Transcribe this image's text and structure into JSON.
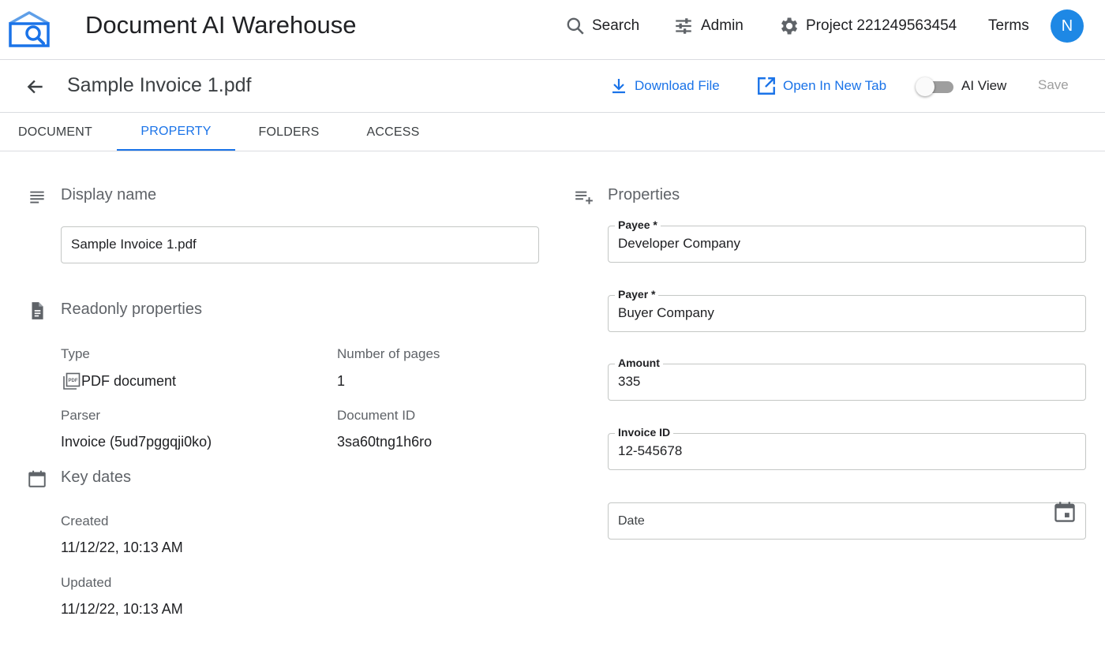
{
  "app": {
    "title": "Document AI Warehouse"
  },
  "topnav": {
    "search": "Search",
    "admin": "Admin",
    "project": "Project 221249563454",
    "terms": "Terms",
    "avatar_initial": "N"
  },
  "doc": {
    "title": "Sample Invoice 1.pdf",
    "download": "Download File",
    "open_new_tab": "Open In New Tab",
    "ai_view": "AI View",
    "save": "Save"
  },
  "tabs": [
    "DOCUMENT",
    "PROPERTY",
    "FOLDERS",
    "ACCESS"
  ],
  "display_name": {
    "title": "Display name",
    "value": "Sample Invoice 1.pdf"
  },
  "readonly": {
    "title": "Readonly properties",
    "type_label": "Type",
    "type_value": "PDF document",
    "pages_label": "Number of pages",
    "pages_value": "1",
    "parser_label": "Parser",
    "parser_value": "Invoice (5ud7pggqji0ko)",
    "docid_label": "Document ID",
    "docid_value": "3sa60tng1h6ro"
  },
  "dates": {
    "title": "Key dates",
    "created_label": "Created",
    "created_value": "11/12/22, 10:13 AM",
    "updated_label": "Updated",
    "updated_value": "11/12/22, 10:13 AM"
  },
  "properties": {
    "title": "Properties",
    "payee_label": "Payee *",
    "payee_value": "Developer Company",
    "payer_label": "Payer *",
    "payer_value": "Buyer Company",
    "amount_label": "Amount",
    "amount_value": "335",
    "invoice_label": "Invoice ID",
    "invoice_value": "12-545678",
    "date_placeholder": "Date"
  },
  "colors": {
    "accent": "#1a73e8",
    "avatar": "#1e88e5"
  }
}
